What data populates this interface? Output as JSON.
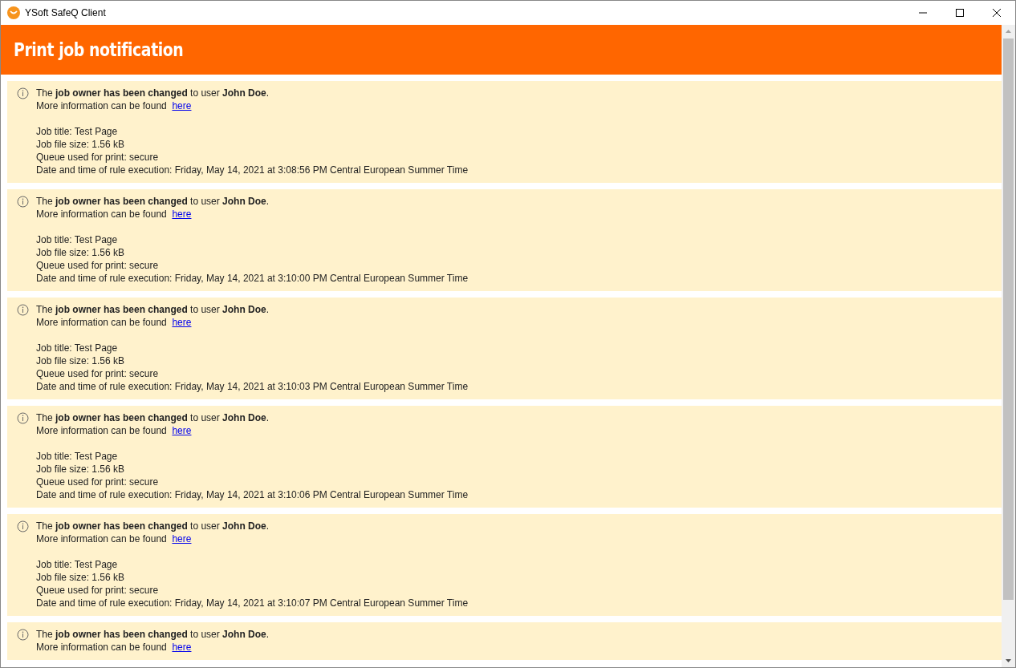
{
  "window": {
    "title": "YSoft SafeQ Client"
  },
  "header": {
    "title": "Print job notification"
  },
  "notifications": [
    {
      "message": "The **job owner has been changed** to user **John Doe**.",
      "more_info": "More information can be found",
      "link": "here",
      "details": [
        "Job title: Test Page",
        "Job file size: 1.56 kB",
        "Queue used for print: secure",
        "Date and time of rule execution: Friday, May 14, 2021 at 3:08:56 PM Central European Summer Time"
      ]
    },
    {
      "message": "The **job owner has been changed** to user **John Doe**.",
      "more_info": "More information can be found",
      "link": "here",
      "details": [
        "Job title: Test Page",
        "Job file size: 1.56 kB",
        "Queue used for print: secure",
        "Date and time of rule execution: Friday, May 14, 2021 at 3:10:00 PM Central European Summer Time"
      ]
    },
    {
      "message": "The **job owner has been changed** to user **John Doe**.",
      "more_info": "More information can be found",
      "link": "here",
      "details": [
        "Job title: Test Page",
        "Job file size: 1.56 kB",
        "Queue used for print: secure",
        "Date and time of rule execution: Friday, May 14, 2021 at 3:10:03 PM Central European Summer Time"
      ]
    },
    {
      "message": "The **job owner has been changed** to user **John Doe**.",
      "more_info": "More information can be found",
      "link": "here",
      "details": [
        "Job title: Test Page",
        "Job file size: 1.56 kB",
        "Queue used for print: secure",
        "Date and time of rule execution: Friday, May 14, 2021 at 3:10:06 PM Central European Summer Time"
      ]
    },
    {
      "message": "The **job owner has been changed** to user **John Doe**.",
      "more_info": "More information can be found",
      "link": "here",
      "details": [
        "Job title: Test Page",
        "Job file size: 1.56 kB",
        "Queue used for print: secure",
        "Date and time of rule execution: Friday, May 14, 2021 at 3:10:07 PM Central European Summer Time"
      ]
    },
    {
      "message": "The **job owner has been changed** to user **John Doe**.",
      "more_info": "More information can be found",
      "link": "here"
    }
  ]
}
